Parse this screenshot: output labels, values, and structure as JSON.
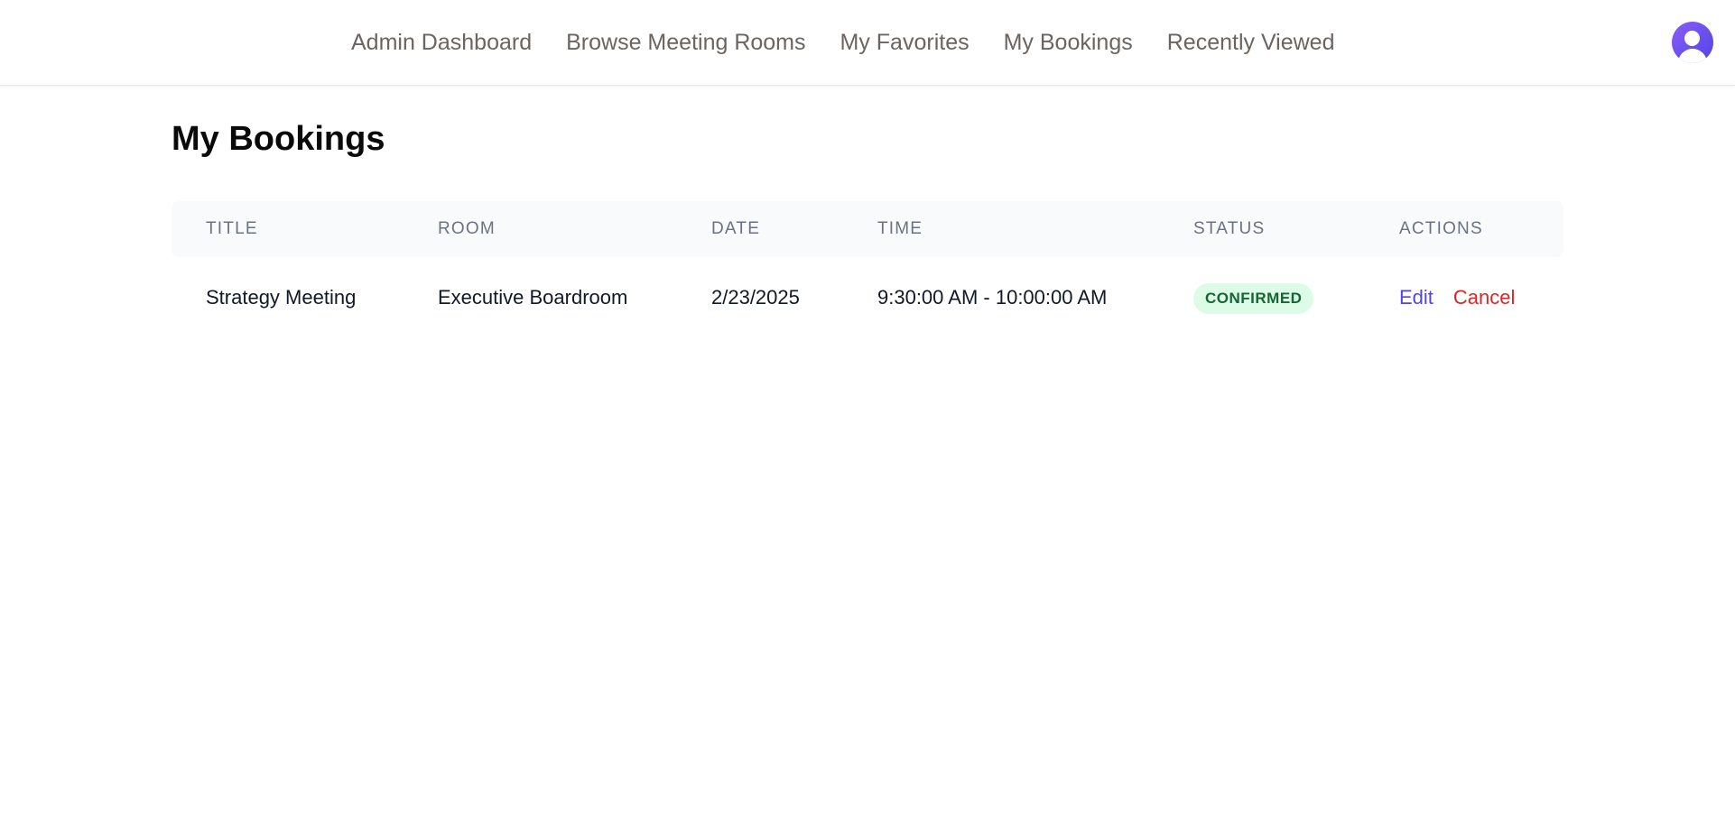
{
  "nav": {
    "links": [
      {
        "label": "Admin Dashboard"
      },
      {
        "label": "Browse Meeting Rooms"
      },
      {
        "label": "My Favorites"
      },
      {
        "label": "My Bookings"
      },
      {
        "label": "Recently Viewed"
      }
    ],
    "avatar_icon": "user-avatar-icon"
  },
  "page": {
    "title": "My Bookings"
  },
  "table": {
    "headers": [
      "TITLE",
      "ROOM",
      "DATE",
      "TIME",
      "STATUS",
      "ACTIONS"
    ],
    "rows": [
      {
        "title": "Strategy Meeting",
        "room": "Executive Boardroom",
        "date": "2/23/2025",
        "time": "9:30:00 AM - 10:00:00 AM",
        "status": "CONFIRMED",
        "edit_label": "Edit",
        "cancel_label": "Cancel"
      }
    ]
  },
  "colors": {
    "accent": "#4f46e5",
    "danger": "#dc2626",
    "status_confirmed_text": "#166534",
    "status_confirmed_bg": "#dcfce7"
  }
}
